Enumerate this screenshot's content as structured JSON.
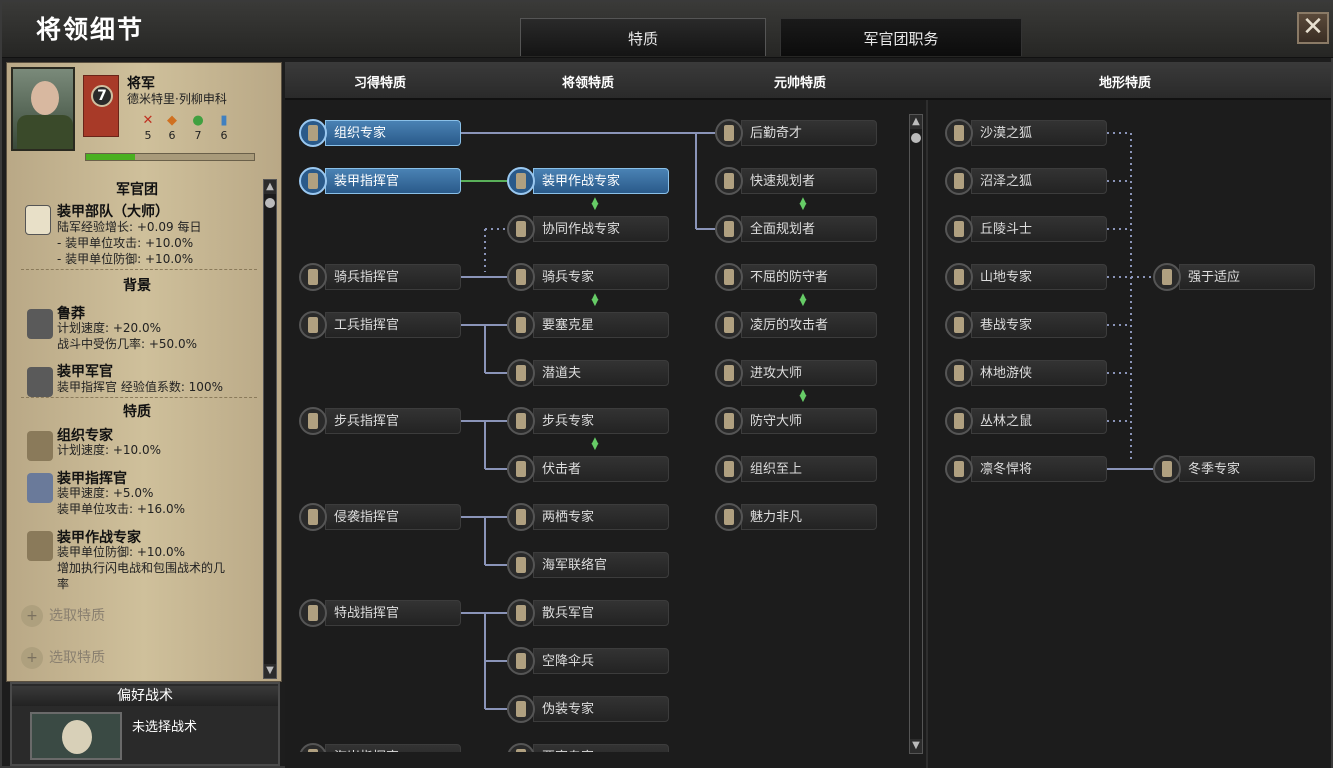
{
  "window": {
    "title": "将领细节",
    "close_label": "✕"
  },
  "tabs": [
    {
      "label": "特质"
    },
    {
      "label": "军官团职务"
    }
  ],
  "general": {
    "rank": "将军",
    "name": "德米特里·列柳申科",
    "skill": "7",
    "stats": [
      {
        "name": "attack-icon",
        "value": "5",
        "color": "#c03020"
      },
      {
        "name": "defense-icon",
        "value": "6",
        "color": "#d07020"
      },
      {
        "name": "planning-icon",
        "value": "7",
        "color": "#40a040"
      },
      {
        "name": "logistics-icon",
        "value": "6",
        "color": "#4080c0"
      }
    ],
    "xp_fraction": 0.29
  },
  "left": {
    "corps_header": "军官团",
    "corps": {
      "title": "装甲部队（大师）",
      "lines": [
        "陆军经验增长: +0.09 每日",
        " - 装甲单位攻击: +10.0%",
        " - 装甲单位防御: +10.0%"
      ]
    },
    "background_header": "背景",
    "background": [
      {
        "title": "鲁莽",
        "lines": [
          "计划速度: +20.0%",
          "战斗中受伤几率: +50.0%"
        ]
      },
      {
        "title": "装甲军官",
        "lines": [
          "装甲指挥官 经验值系数: 100%"
        ]
      }
    ],
    "traits_header": "特质",
    "traits": [
      {
        "title": "组织专家",
        "lines": [
          "计划速度: +10.0%"
        ]
      },
      {
        "title": "装甲指挥官",
        "lines": [
          "装甲速度: +5.0%",
          "装甲单位攻击: +16.0%"
        ]
      },
      {
        "title": "装甲作战专家",
        "lines": [
          "装甲单位防御: +10.0%",
          "增加执行闪电战和包围战术的几",
          "率"
        ]
      }
    ],
    "add_trait_label": "选取特质"
  },
  "tactics": {
    "title": "偏好战术",
    "none_label": "未选择战术"
  },
  "columns": {
    "learned": "习得特质",
    "general": "将领特质",
    "field_marshal": "元帅特质",
    "terrain": "地形特质"
  },
  "tree": {
    "learned": [
      "组织专家",
      "装甲指挥官",
      "骑兵指挥官",
      "工兵指挥官",
      "步兵指挥官",
      "侵袭指挥官",
      "特战指挥官",
      "海岸指挥官"
    ],
    "general": [
      "装甲作战专家",
      "协同作战专家",
      "骑兵专家",
      "要塞克星",
      "潜道夫",
      "步兵专家",
      "伏击者",
      "两栖专家",
      "海军联络官",
      "散兵军官",
      "空降伞兵",
      "伪装专家",
      "要塞专家"
    ],
    "field_marshal": [
      "后勤奇才",
      "快速规划者",
      "全面规划者",
      "不屈的防守者",
      "凌厉的攻击者",
      "进攻大师",
      "防守大师",
      "组织至上",
      "魅力非凡"
    ],
    "terrain_left": [
      "沙漠之狐",
      "沼泽之狐",
      "丘陵斗士",
      "山地专家",
      "巷战专家",
      "林地游侠",
      "丛林之鼠",
      "凛冬悍将"
    ],
    "terrain_right": [
      "强于适应",
      "冬季专家"
    ]
  },
  "colors": {
    "selected": "#3a7ab0",
    "link_line": "#8a94b8",
    "active_link": "#5ab05a"
  }
}
